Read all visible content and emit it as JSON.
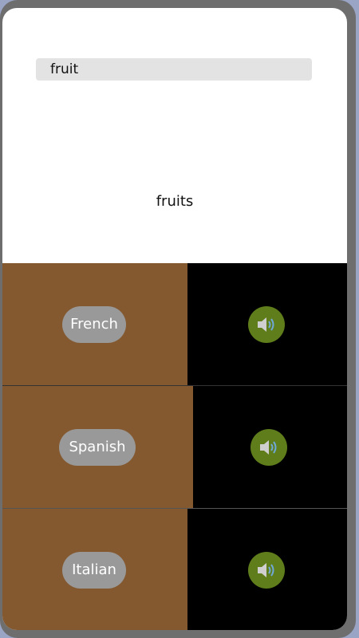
{
  "search": {
    "value": "fruit"
  },
  "result": {
    "word": "fruits"
  },
  "languages": [
    {
      "label": "French",
      "speaker_icon": "speaker-icon"
    },
    {
      "label": "Spanish",
      "speaker_icon": "speaker-icon"
    },
    {
      "label": "Italian",
      "speaker_icon": "speaker-icon"
    }
  ],
  "colors": {
    "left_panel": "#845930",
    "right_panel": "#000000",
    "language_button": "#999999",
    "speaker_button": "#5f7e1b"
  }
}
